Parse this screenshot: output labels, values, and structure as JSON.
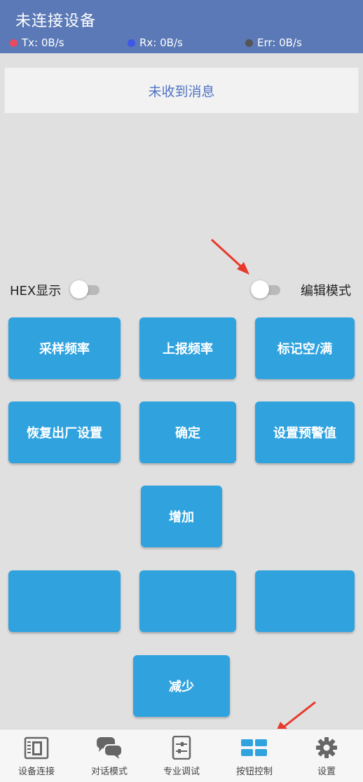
{
  "header": {
    "title": "未连接设备",
    "tx": "Tx: 0B/s",
    "rx": "Rx: 0B/s",
    "err": "Err: 0B/s",
    "colors": {
      "tx": "#e84a5f",
      "rx": "#3d57e8",
      "err": "#555555"
    }
  },
  "message": {
    "text": "未收到消息"
  },
  "toggles": {
    "hex_label": "HEX显示",
    "hex_on": false,
    "edit_label": "编辑模式",
    "edit_on": false
  },
  "buttons": {
    "sample_rate": "采样频率",
    "report_rate": "上报频率",
    "mark_empty_full": "标记空/满",
    "factory_reset": "恢复出厂设置",
    "confirm": "确定",
    "set_alarm": "设置预警值",
    "increase": "增加",
    "blank1": "",
    "blank2": "",
    "blank3": "",
    "decrease": "减少"
  },
  "nav": {
    "items": [
      {
        "label": "设备连接",
        "icon": "device-connect-icon"
      },
      {
        "label": "对话模式",
        "icon": "chat-icon"
      },
      {
        "label": "专业调试",
        "icon": "debug-sliders-icon"
      },
      {
        "label": "按钮控制",
        "icon": "button-grid-icon",
        "active": true
      },
      {
        "label": "设置",
        "icon": "gear-icon"
      }
    ]
  },
  "colors": {
    "header_bg": "#5b79b6",
    "button": "#30a3df",
    "annotation_arrow": "#e8392c"
  }
}
